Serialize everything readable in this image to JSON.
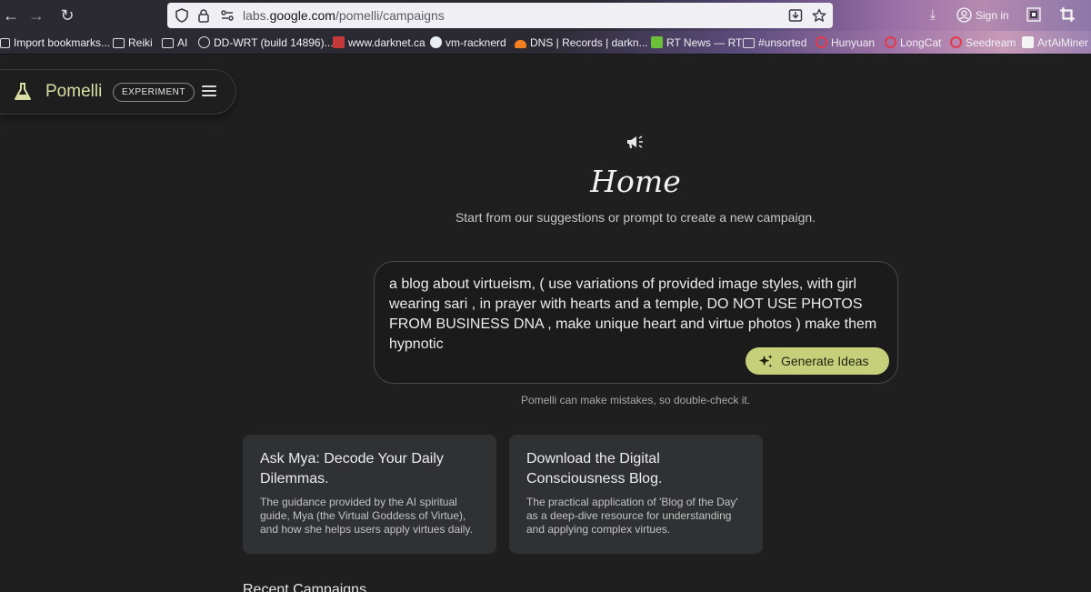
{
  "browser": {
    "url_prefix": "labs.",
    "url_domain": "google.com",
    "url_path": "/pomelli/campaigns",
    "signin_label": "Sign in",
    "bookmarks": [
      {
        "label": "Import bookmarks...",
        "icon": "import-icon"
      },
      {
        "label": "Reiki",
        "icon": "folder-icon"
      },
      {
        "label": "AI",
        "icon": "folder-icon"
      },
      {
        "label": "DD-WRT (build 14896)...",
        "icon": "globe-icon"
      },
      {
        "label": "www.darknet.ca",
        "icon": "site-icon"
      },
      {
        "label": "vm-racknerd",
        "icon": "site-icon"
      },
      {
        "label": "DNS | Records | darkn...",
        "icon": "cloudflare-icon"
      },
      {
        "label": "RT News — RT",
        "icon": "rt-icon"
      },
      {
        "label": "#unsorted",
        "icon": "folder-icon"
      },
      {
        "label": "Hunyuan",
        "icon": "site-icon"
      },
      {
        "label": "LongCat",
        "icon": "site-icon"
      },
      {
        "label": "Seedream",
        "icon": "site-icon"
      },
      {
        "label": "ArtAiMiner |",
        "icon": "site-icon"
      }
    ]
  },
  "app": {
    "brand": "Pomelli",
    "badge": "EXPERIMENT",
    "accent": "#c6cf7a"
  },
  "home": {
    "title": "Home",
    "subtitle": "Start from our suggestions or prompt to create a new campaign.",
    "prompt_value": "a blog about virtueism, ( use variations of provided image styles, with girl wearing sari , in prayer with hearts and a temple, DO NOT USE PHOTOS FROM BUSINESS DNA , make unique heart and virtue photos ) make them hypnotic",
    "generate_label": "Generate Ideas",
    "disclaimer": "Pomelli can make mistakes, so double-check it."
  },
  "suggestions": [
    {
      "title": "Ask Mya: Decode Your Daily Dilemmas.",
      "description": "The guidance provided by the AI spiritual guide, Mya (the Virtual Goddess of Virtue), and how she helps users apply virtues daily."
    },
    {
      "title": "Download the Digital Consciousness Blog.",
      "description": "The practical application of 'Blog of the Day' as a deep-dive resource for understanding and applying complex virtues."
    }
  ],
  "recent_heading": "Recent Campaigns"
}
